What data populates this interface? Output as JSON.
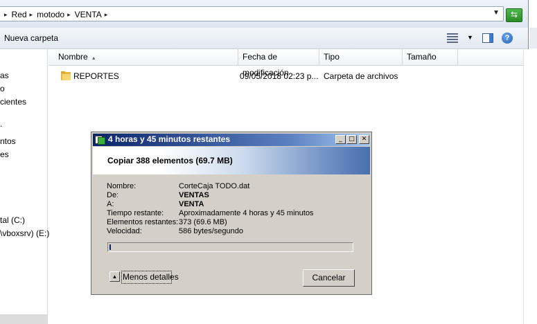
{
  "address": {
    "crumbs": [
      "Red",
      "motodo",
      "VENTA"
    ],
    "refresh_icon": "refresh-go-icon"
  },
  "toolbar": {
    "new_folder_label": "Nueva carpeta",
    "views_icon": "views-icon",
    "preview_icon": "preview-pane-icon",
    "help_label": "?"
  },
  "nav": {
    "items": [
      "as",
      "o",
      "cientes",
      ".",
      "ntos",
      "es",
      "tal (C:)",
      "\\vboxsrv) (E:)"
    ]
  },
  "columns": {
    "name": "Nombre",
    "modified": "Fecha de modificación",
    "type": "Tipo",
    "size": "Tamaño"
  },
  "files": [
    {
      "name": "REPORTES",
      "modified": "09/05/2018 02:23 p...",
      "type": "Carpeta de archivos",
      "size": ""
    }
  ],
  "dialog": {
    "title": "4 horas y 45 minutos restantes",
    "banner": "Copiar 388 elementos (69.7 MB)",
    "details": [
      {
        "label": "Nombre:",
        "value": "CorteCaja TODO.dat",
        "bold": false
      },
      {
        "label": "De:",
        "value": "VENTAS",
        "bold": true
      },
      {
        "label": "A:",
        "value": "VENTA",
        "bold": true
      },
      {
        "label": "Tiempo restante:",
        "value": "Aproximadamente 4 horas y 45 minutos",
        "bold": false
      },
      {
        "label": "Elementos restantes:",
        "value": "373 (69.6 MB)",
        "bold": false
      },
      {
        "label": "Velocidad:",
        "value": "586 bytes/segundo",
        "bold": false
      }
    ],
    "progress_percent": 0.4,
    "less_details_label": "Menos detalles",
    "cancel_label": "Cancelar",
    "minimize_glyph": "_",
    "maximize_glyph": "□",
    "close_glyph": "✕"
  }
}
